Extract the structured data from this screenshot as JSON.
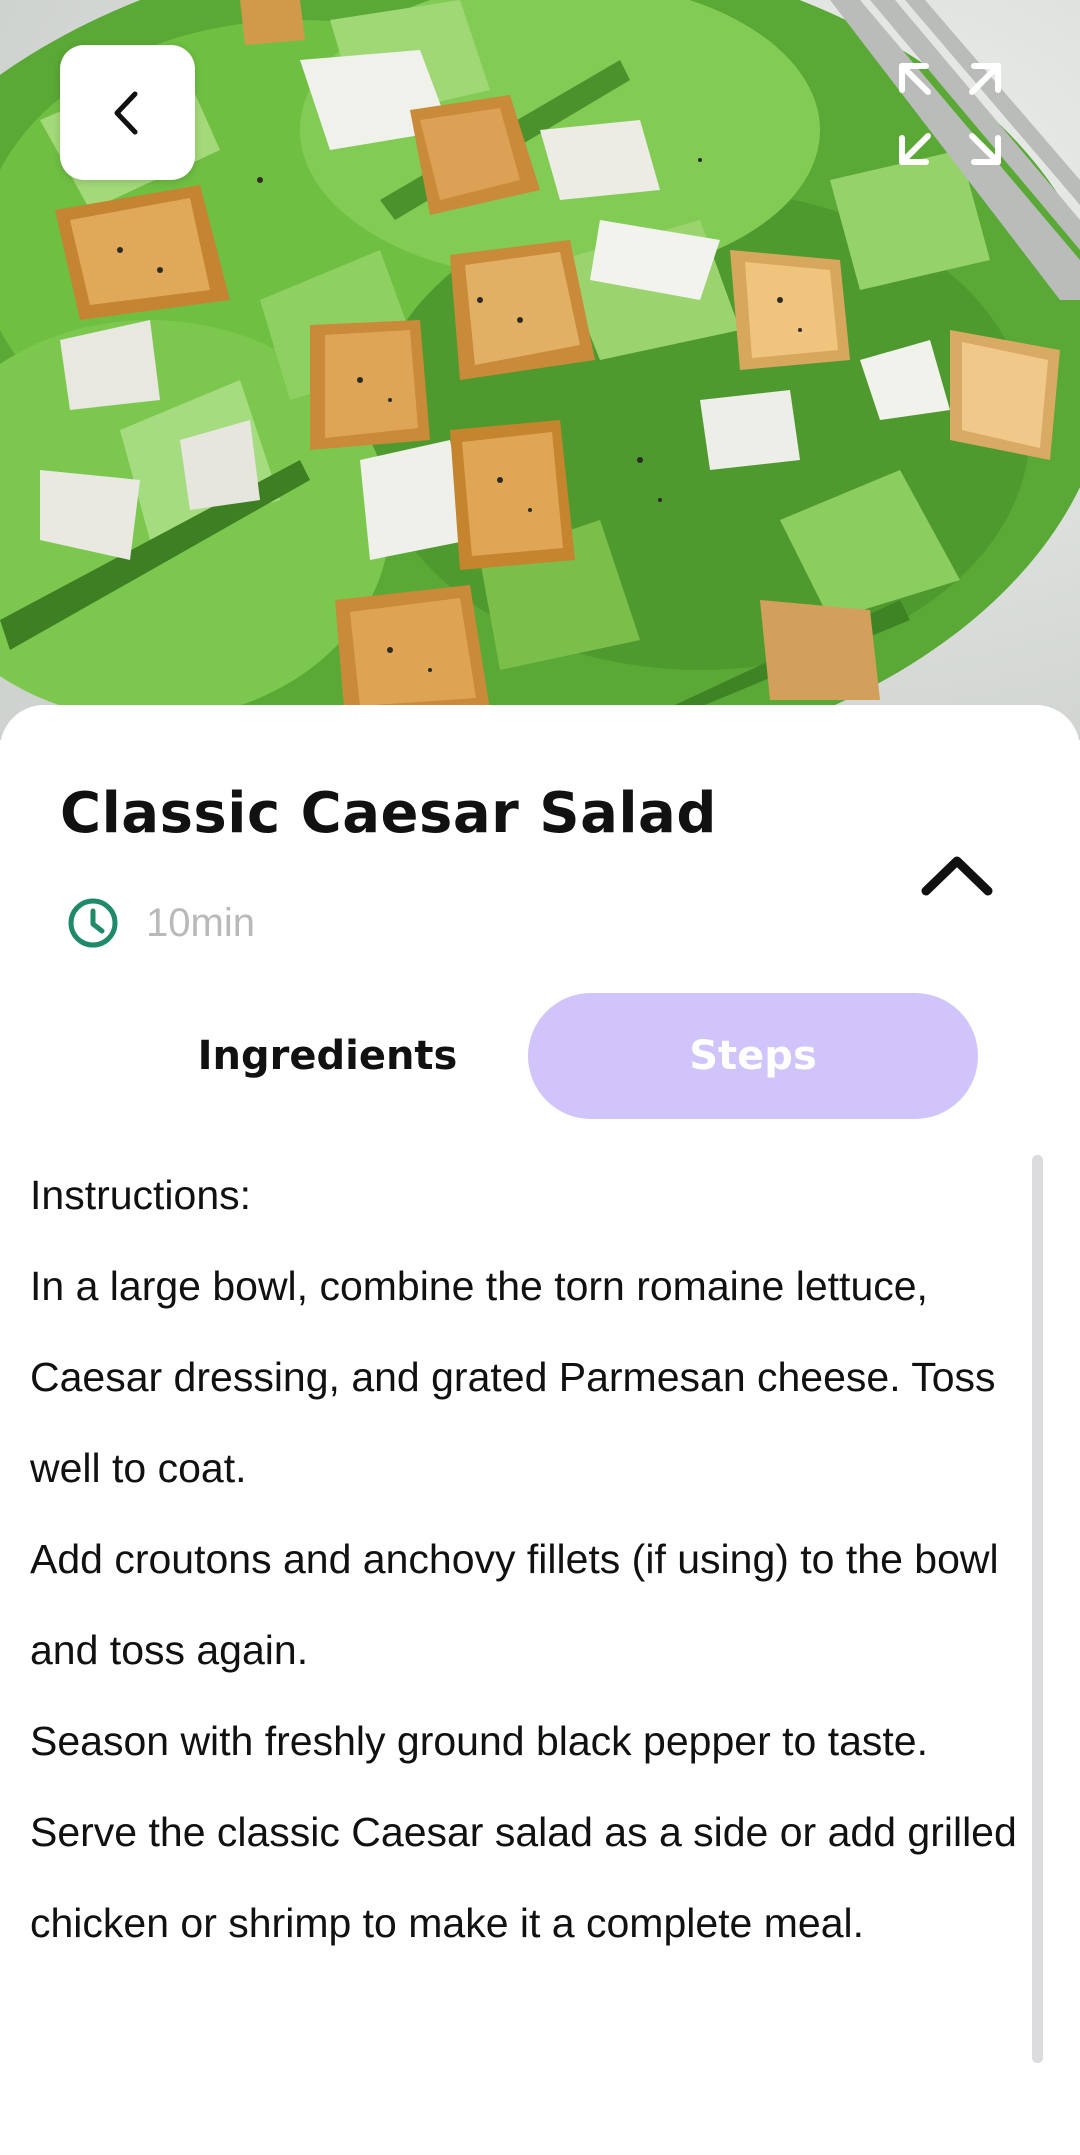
{
  "recipe": {
    "title": "Classic Caesar Salad",
    "time": "10min"
  },
  "icons": {
    "back": "chevron-left-icon",
    "expand": "expand-icon",
    "collapse": "chevron-up-icon",
    "time": "clock-icon"
  },
  "tabs": [
    {
      "label": "Ingredients",
      "active": false
    },
    {
      "label": "Steps",
      "active": true
    }
  ],
  "steps": {
    "heading": "Instructions:",
    "items": [
      "In a large bowl, combine the torn romaine lettuce, Caesar dressing, and grated Parmesan cheese. Toss well to coat.",
      "Add croutons and anchovy fillets (if using) to the bowl and toss again.",
      "Season with freshly ground black pepper to taste.",
      "Serve the classic Caesar salad as a side or add grilled chicken or shrimp to make it a complete meal."
    ]
  },
  "colors": {
    "accent": "#d1c4fb",
    "clock": "#1f8a6a",
    "muted_text": "#b9b9b9"
  }
}
